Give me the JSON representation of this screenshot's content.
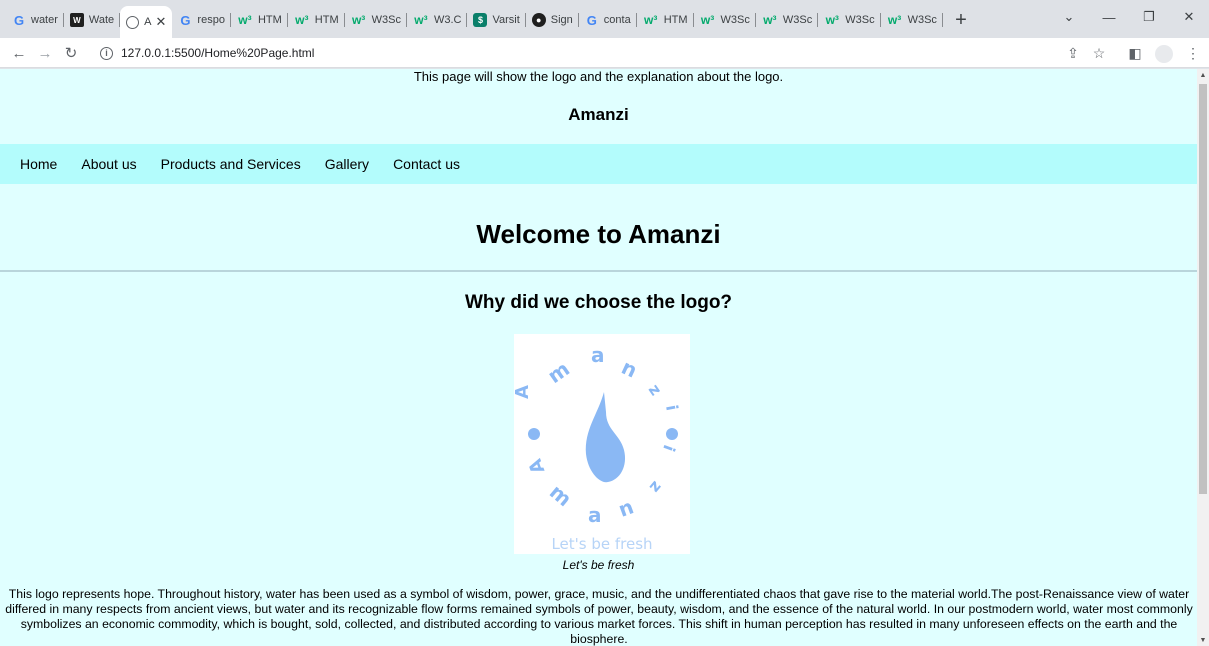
{
  "browser": {
    "tabs": [
      {
        "icon": "google-icon",
        "label": "water"
      },
      {
        "icon": "water-site-icon",
        "label": "Wate"
      },
      {
        "icon": "globe-icon",
        "label": "A",
        "active": true
      },
      {
        "icon": "google-icon",
        "label": "respo"
      },
      {
        "icon": "w3schools-icon",
        "label": "HTM"
      },
      {
        "icon": "w3schools-icon",
        "label": "HTM"
      },
      {
        "icon": "w3schools-icon",
        "label": "W3Sc"
      },
      {
        "icon": "w3schools-icon",
        "label": "W3.C"
      },
      {
        "icon": "varsity-icon",
        "label": "Varsit"
      },
      {
        "icon": "github-icon",
        "label": "Sign"
      },
      {
        "icon": "google-icon",
        "label": "conta"
      },
      {
        "icon": "w3schools-icon",
        "label": "HTM"
      },
      {
        "icon": "w3schools-icon",
        "label": "W3Sc"
      },
      {
        "icon": "w3schools-icon",
        "label": "W3Sc"
      },
      {
        "icon": "w3schools-icon",
        "label": "W3Sc"
      },
      {
        "icon": "w3schools-icon",
        "label": "W3Sc"
      }
    ],
    "url": "127.0.0.1:5500/Home%20Page.html"
  },
  "page": {
    "intro": "This page will show the logo and the explanation about the logo.",
    "brand": "Amanzi",
    "nav": [
      "Home",
      "About us",
      "Products and Services",
      "Gallery",
      "Contact us"
    ],
    "welcome": "Welcome to Amanzi",
    "why_heading": "Why did we choose the logo?",
    "logo": {
      "ring_text": "amanzi",
      "tagline": "Let's be fresh",
      "color": "#8ab8f4"
    },
    "caption": "Let's be fresh",
    "paragraph": "This logo represents hope. Throughout history, water has been used as a symbol of wisdom, power, grace, music, and the undifferentiated chaos that gave rise to the material world.The post-Renaissance view of water differed in many respects from ancient views, but water and its recognizable flow forms remained symbols of power, beauty, wisdom, and the essence of the natural world. In our postmodern world, water most commonly symbolizes an economic commodity, which is bought, sold, collected, and distributed according to various market forces. This shift in human perception has resulted in many unforeseen effects on the earth and the biosphere."
  }
}
